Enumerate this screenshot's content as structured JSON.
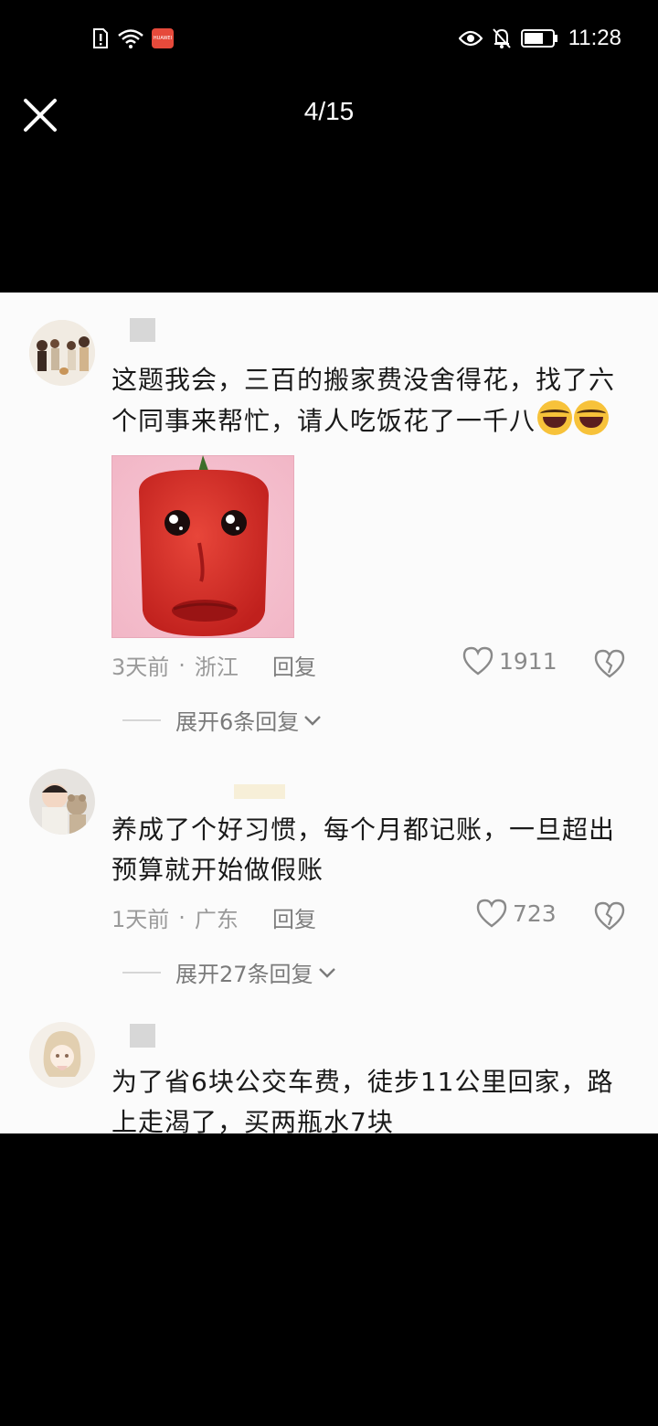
{
  "status_bar": {
    "time": "11:28",
    "carrier_badge": "HUAWEI"
  },
  "viewer": {
    "counter": "4/15"
  },
  "comments": [
    {
      "text": "这题我会，三百的搬家费没舍得花，找了六个同事来帮忙，请人吃饭花了一千八",
      "time": "3天前",
      "location": "浙江",
      "reply": "回复",
      "likes": "1911",
      "expand": "展开6条回复"
    },
    {
      "text": "养成了个好习惯，每个月都记账，一旦超出预算就开始做假账",
      "time": "1天前",
      "location": "广东",
      "reply": "回复",
      "likes": "723",
      "expand": "展开27条回复"
    },
    {
      "text": "为了省6块公交车费，徒步11公里回家，路上走渴了，买两瓶水7块"
    }
  ],
  "colors": {
    "background": "#000000",
    "panel": "#fbfbfb",
    "meta_text": "#9a9a9a",
    "pepper": "#d62a24"
  },
  "icons": [
    "close-icon",
    "eye-icon",
    "bell-off-icon",
    "battery-icon",
    "wifi-icon",
    "sim-alert-icon",
    "heart-icon",
    "broken-heart-icon",
    "chevron-down-icon",
    "laughing-emoji-icon"
  ]
}
